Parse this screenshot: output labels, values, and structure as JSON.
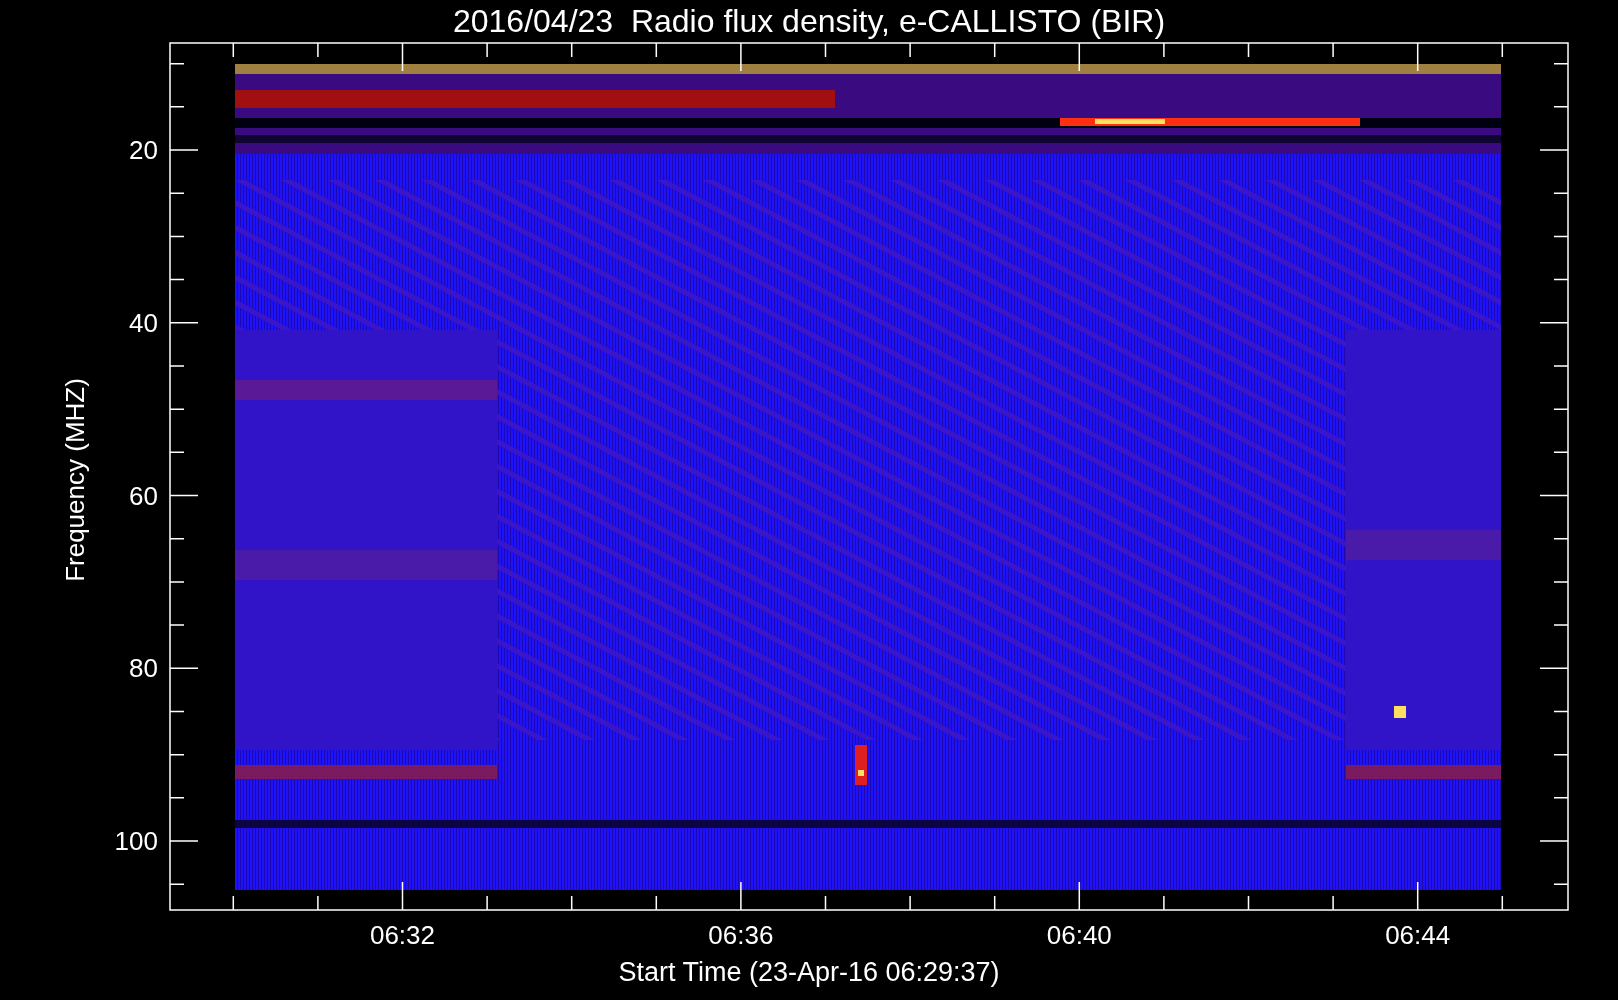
{
  "title": "2016/04/23  Radio flux density, e-CALLISTO (BIR)",
  "plot": {
    "ylabel": "Frequency (MHZ)",
    "xlabel": "Start Time (23-Apr-16 06:29:37)",
    "yticks": [
      "20",
      "40",
      "60",
      "80",
      "100"
    ],
    "xticks": [
      "06:32",
      "06:36",
      "06:40",
      "06:44"
    ]
  }
}
